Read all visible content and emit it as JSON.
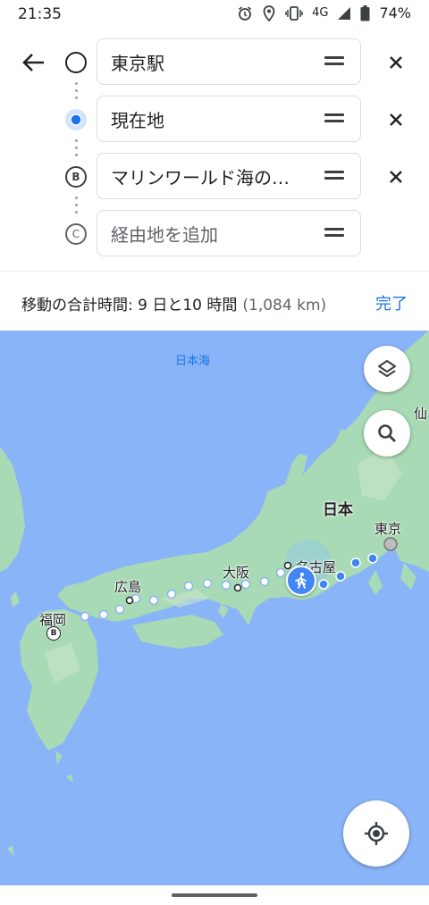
{
  "status_bar": {
    "time": "21:35",
    "network": "4G",
    "battery": "74%",
    "icons": [
      "alarm-icon",
      "location-icon",
      "vibrate-icon",
      "signal-icon",
      "battery-icon"
    ]
  },
  "route": {
    "stops": [
      {
        "label": "東京駅",
        "marker": "origin-circle"
      },
      {
        "label": "現在地",
        "marker": "current-location-dot"
      },
      {
        "label": "マリンワールド海の…",
        "marker": "B"
      }
    ],
    "add_stop": {
      "placeholder": "経由地を追加",
      "marker": "C"
    }
  },
  "summary": {
    "label": "移動の合計時間: 9 日と10 時間",
    "distance": "(1,084 km)",
    "done": "完了"
  },
  "map": {
    "labels": {
      "sea_of_japan": "日本海",
      "japan": "日本",
      "tokyo": "東京",
      "nagoya": "名古屋",
      "osaka": "大阪",
      "hiroshima": "広島",
      "fukuoka": "福岡",
      "sendai_partial": "仙"
    },
    "marker_fukuoka": "B",
    "colors": {
      "sea": "#8ab4f8",
      "land": "#a8dab5",
      "route": "#4285f4"
    }
  }
}
